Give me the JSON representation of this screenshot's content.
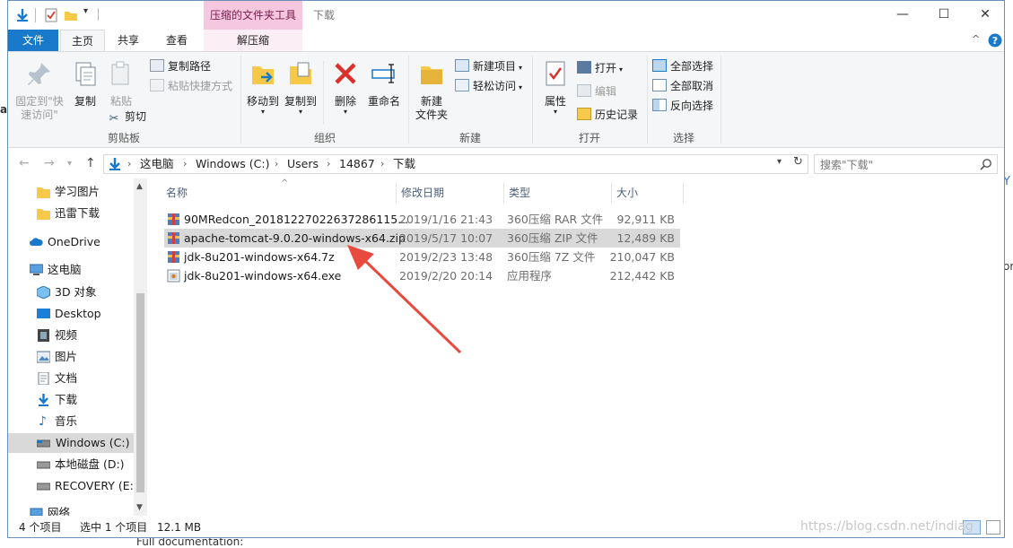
{
  "background": {
    "fragments": [
      "Y",
      "ar",
      "or",
      "Full documentation:"
    ]
  },
  "titlebar": {
    "context_tab": "压缩的文件夹工具",
    "title": "下载",
    "minimize": "—",
    "maximize": "☐",
    "close": "✕"
  },
  "tabs": {
    "file": "文件",
    "home": "主页",
    "share": "共享",
    "view": "查看",
    "unzip": "解压缩"
  },
  "ribbon": {
    "clipboard": {
      "label": "剪贴板",
      "pin": "固定到\"快\n速访问\"",
      "copy": "复制",
      "paste": "粘贴",
      "copy_path": "复制路径",
      "paste_shortcut": "粘贴快捷方式",
      "cut": "剪切"
    },
    "organize": {
      "label": "组织",
      "move_to": "移动到",
      "copy_to": "复制到",
      "delete": "删除",
      "rename": "重命名"
    },
    "new": {
      "label": "新建",
      "new_folder": "新建\n文件夹",
      "new_item": "新建项目",
      "easy_access": "轻松访问"
    },
    "open": {
      "label": "打开",
      "properties": "属性",
      "open": "打开",
      "edit": "编辑",
      "history": "历史记录"
    },
    "select": {
      "label": "选择",
      "select_all": "全部选择",
      "select_none": "全部取消",
      "invert": "反向选择"
    }
  },
  "address": {
    "crumbs": [
      "这电脑",
      "Windows (C:)",
      "Users",
      "14867",
      "下载"
    ],
    "search_placeholder": "搜索\"下载\""
  },
  "navpane": {
    "items": [
      {
        "label": "学习图片",
        "icon": "folder-icon"
      },
      {
        "label": "迅雷下载",
        "icon": "folder-icon"
      },
      {
        "label": "OneDrive",
        "icon": "cloud-icon"
      },
      {
        "label": "这电脑",
        "icon": "computer-icon"
      },
      {
        "label": "3D 对象",
        "icon": "cube-icon"
      },
      {
        "label": "Desktop",
        "icon": "desktop-icon"
      },
      {
        "label": "视频",
        "icon": "video-icon"
      },
      {
        "label": "图片",
        "icon": "picture-icon"
      },
      {
        "label": "文档",
        "icon": "document-icon"
      },
      {
        "label": "下载",
        "icon": "download-icon"
      },
      {
        "label": "音乐",
        "icon": "music-icon"
      },
      {
        "label": "Windows (C:)",
        "icon": "drive-icon"
      },
      {
        "label": "本地磁盘 (D:)",
        "icon": "drive-icon"
      },
      {
        "label": "RECOVERY (E:)",
        "icon": "drive-icon"
      },
      {
        "label": "网络",
        "icon": "network-icon"
      }
    ]
  },
  "filelist": {
    "columns": {
      "name": "名称",
      "date": "修改日期",
      "type": "类型",
      "size": "大小"
    },
    "rows": [
      {
        "name": "90MRedcon_20181227022637286115...",
        "date": "2019/1/16 21:43",
        "type": "360压缩 RAR 文件",
        "size": "92,911 KB",
        "icon": "archive-icon",
        "selected": false
      },
      {
        "name": "apache-tomcat-9.0.20-windows-x64.zip",
        "date": "2019/5/17 10:07",
        "type": "360压缩 ZIP 文件",
        "size": "12,489 KB",
        "icon": "archive-icon",
        "selected": true
      },
      {
        "name": "jdk-8u201-windows-x64.7z",
        "date": "2019/2/23 13:48",
        "type": "360压缩 7Z 文件",
        "size": "210,047 KB",
        "icon": "archive-icon",
        "selected": false
      },
      {
        "name": "jdk-8u201-windows-x64.exe",
        "date": "2019/2/20 20:14",
        "type": "应用程序",
        "size": "212,442 KB",
        "icon": "installer-icon",
        "selected": false
      }
    ]
  },
  "status": {
    "count": "4 个项目",
    "selected": "选中 1 个项目",
    "size": "12.1 MB"
  },
  "watermark": "https://blog.csdn.net/indiag",
  "colors": {
    "accent": "#1979ca",
    "context_tab": "#f5c8e0",
    "selection": "#d9d9d9",
    "arrow": "#e84a3f"
  }
}
